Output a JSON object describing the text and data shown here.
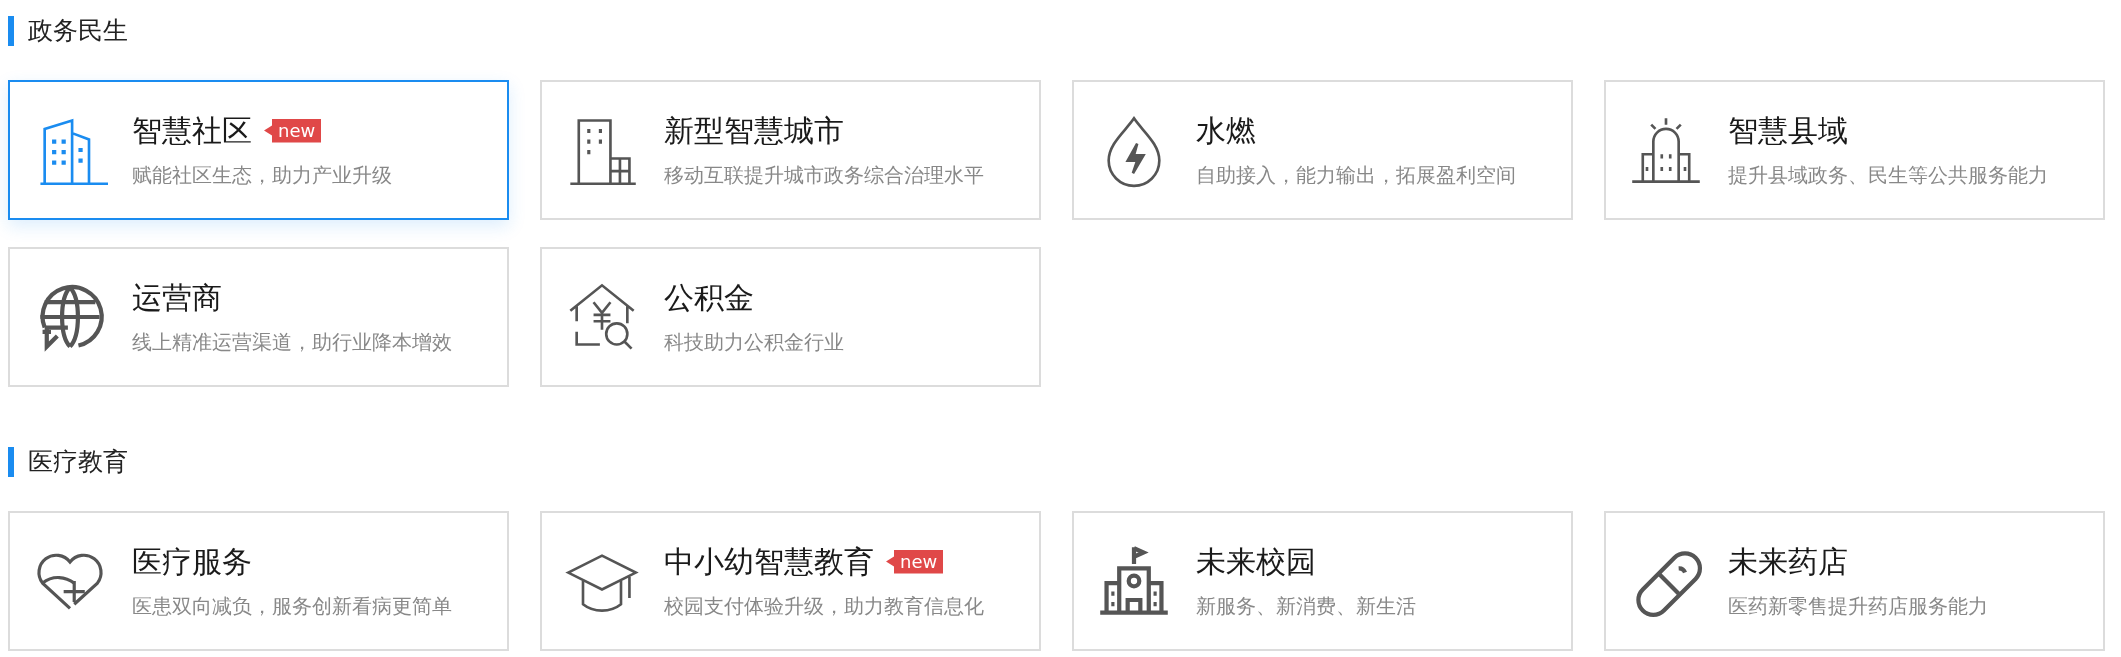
{
  "sections": [
    {
      "title": "政务民生",
      "cards": [
        {
          "kind": "buildings",
          "title": "智慧社区",
          "badge": "new",
          "subtitle": "赋能社区生态，助力产业升级",
          "selected": true
        },
        {
          "kind": "office",
          "title": "新型智慧城市",
          "subtitle": "移动互联提升城市政务综合治理水平",
          "selected": false
        },
        {
          "kind": "drop",
          "title": "水燃",
          "subtitle": "自助接入，能力输出，拓展盈利空间",
          "selected": false
        },
        {
          "kind": "county",
          "title": "智慧县域",
          "subtitle": "提升县域政务、民生等公共服务能力",
          "selected": false
        },
        {
          "kind": "globe",
          "title": "运营商",
          "subtitle": "线上精准运营渠道，助行业降本增效",
          "selected": false
        },
        {
          "kind": "house",
          "title": "公积金",
          "subtitle": "科技助力公积金行业",
          "selected": false
        }
      ]
    },
    {
      "title": "医疗教育",
      "cards": [
        {
          "kind": "heart",
          "title": "医疗服务",
          "subtitle": "医患双向减负，服务创新看病更简单",
          "selected": false
        },
        {
          "kind": "cap",
          "title": "中小幼智慧教育",
          "badge": "new",
          "subtitle": "校园支付体验升级，助力教育信息化",
          "selected": false
        },
        {
          "kind": "school",
          "title": "未来校园",
          "subtitle": "新服务、新消费、新生活",
          "selected": false
        },
        {
          "kind": "pill",
          "title": "未来药店",
          "subtitle": "医药新零售提升药店服务能力",
          "selected": false
        }
      ]
    }
  ]
}
